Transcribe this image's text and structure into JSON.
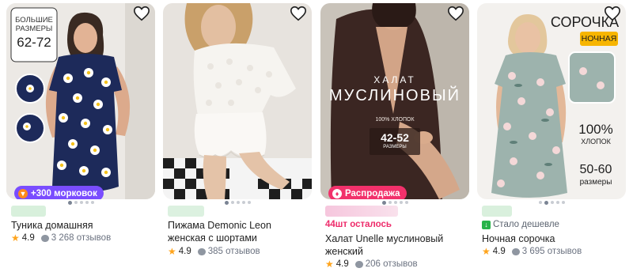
{
  "products": [
    {
      "overlay": {
        "line1": "БОЛЬШИЕ",
        "line2": "РАЗМЕРЫ",
        "sizes": "62-72"
      },
      "badge": "+300 морковок",
      "badge_color": "#7a4dff",
      "title": "Туника домашняя",
      "rating": "4.9",
      "reviews": "3 268 отзывов",
      "dots": 5,
      "active_dot": 0,
      "price_blur_color": "#d8f0dc"
    },
    {
      "title": "Пижама Demonic Leon женская с шортами",
      "rating": "4.9",
      "reviews": "385 отзывов",
      "dots": 5,
      "active_dot": 0,
      "price_blur_color": "#dcf1e0"
    },
    {
      "overlay": {
        "line1": "ХАЛАТ",
        "line2": "МУСЛИНОВЫЙ",
        "line3": "100% ХЛОПОК",
        "sizes": "42-52",
        "sizes_caption": "РАЗМЕРЫ"
      },
      "badge": "Распродажа",
      "badge_color": "#f2316b",
      "note": "44шт осталось",
      "title": "Халат Unelle муслиновый женский",
      "rating": "4.9",
      "reviews": "206 отзывов",
      "dots": 5,
      "active_dot": 0,
      "price_blur_color": "#f7d3e6"
    },
    {
      "overlay": {
        "line1": "СОРОЧКА",
        "tag": "НОЧНАЯ",
        "pct": "100%",
        "pct_caption": "ХЛОПОК",
        "sizes": "50-60",
        "sizes_caption": "размеры"
      },
      "note": "Стало дешевле",
      "title": "Ночная сорочка",
      "rating": "4.9",
      "reviews": "3 695 отзывов",
      "dots": 5,
      "active_dot": 1,
      "price_blur_color": "#d9f0dd"
    }
  ],
  "icons": {
    "favorite": "heart-outline-icon",
    "rating": "star-icon",
    "reviews": "speech-bubble-icon",
    "carrot": "carrot-icon",
    "sale": "flame-icon",
    "price_drop": "arrow-down-icon"
  },
  "colors": {
    "accent_pink": "#ee2c6b",
    "rating_star": "#ffa41c",
    "price_drop_green": "#28b34a"
  }
}
